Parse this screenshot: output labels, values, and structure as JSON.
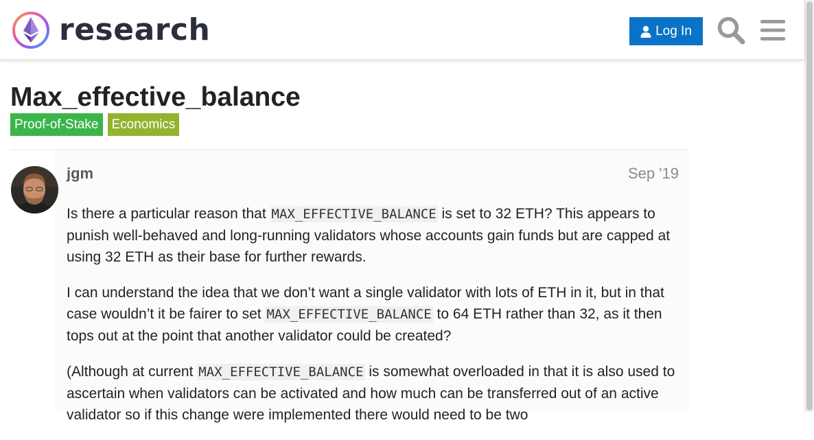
{
  "header": {
    "logo_text": "research",
    "login_label": "Log In",
    "icons": [
      "ethereum-logo-icon",
      "user-icon",
      "search-icon",
      "hamburger-menu-icon"
    ]
  },
  "topic": {
    "title": "Max_effective_balance",
    "tags": [
      {
        "label": "Proof-of-Stake",
        "color": "#3bb54a"
      },
      {
        "label": "Economics",
        "color": "#93b32e"
      }
    ]
  },
  "post": {
    "author": "jgm",
    "date": "Sep '19",
    "p1": {
      "before": "Is there a particular reason that ",
      "code": "MAX_EFFECTIVE_BALANCE",
      "after": " is set to 32 ETH? This appears to punish well-behaved and long-running validators whose accounts gain funds but are capped at using 32 ETH as their base for further rewards."
    },
    "p2": {
      "before": "I can understand the idea that we don’t want a single validator with lots of ETH in it, but in that case wouldn’t it be fairer to set ",
      "code": "MAX_EFFECTIVE_BALANCE",
      "after": " to 64 ETH rather than 32, as it then tops out at the point that another validator could be created?"
    },
    "p3": {
      "before": "(Although at current ",
      "code": "MAX_EFFECTIVE_BALANCE",
      "after": " is somewhat overloaded in that it is also used to ascertain when validators can be activated and how much can be transferred out of an active validator so if this change were implemented there would need to be two"
    }
  },
  "colors": {
    "login_button": "#0a73c7",
    "title": "#222222",
    "username": "#5a5a5a",
    "date": "#8a8a8a"
  }
}
